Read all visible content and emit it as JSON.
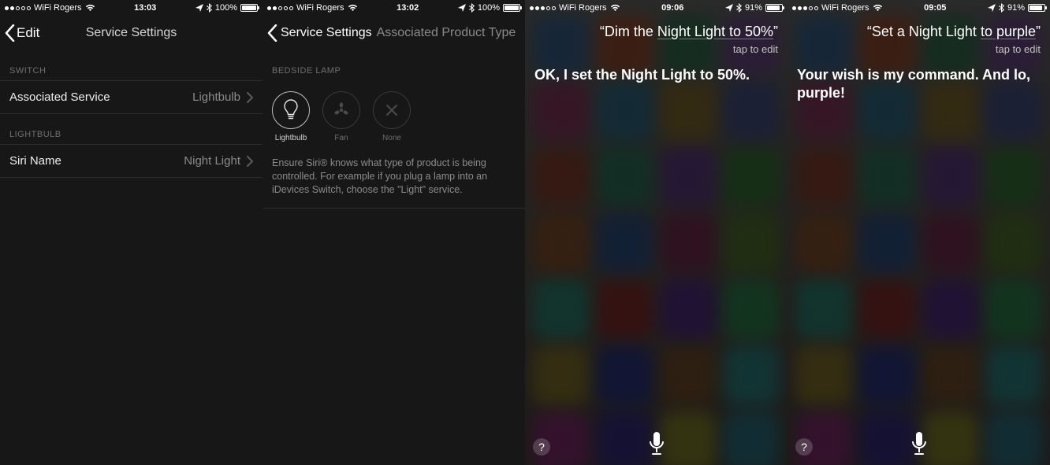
{
  "screens": [
    {
      "status": {
        "carrier": "WiFi Rogers",
        "time": "13:03",
        "battery_pct": "100%",
        "signal_filled": 2,
        "battery_fill_pct": 100
      },
      "nav": {
        "back_label": "Edit",
        "title": "Service Settings"
      },
      "sections": {
        "switch": {
          "header": "SWITCH",
          "row": {
            "label": "Associated Service",
            "value": "Lightbulb"
          }
        },
        "lightbulb": {
          "header": "LIGHTBULB",
          "row": {
            "label": "Siri Name",
            "value": "Night Light"
          }
        }
      }
    },
    {
      "status": {
        "carrier": "WiFi Rogers",
        "time": "13:02",
        "battery_pct": "100%",
        "signal_filled": 2,
        "battery_fill_pct": 100
      },
      "nav": {
        "back_label": "",
        "title": "Service Settings",
        "subtitle": "Associated Product Type"
      },
      "section_header": "BEDSIDE LAMP",
      "types": [
        {
          "key": "lightbulb",
          "label": "Lightbulb",
          "selected": true
        },
        {
          "key": "fan",
          "label": "Fan",
          "selected": false
        },
        {
          "key": "none",
          "label": "None",
          "selected": false
        }
      ],
      "help": "Ensure Siri® knows what type of product is being controlled.  For example if you plug a lamp into an iDevices Switch, choose the \"Light\" service."
    },
    {
      "status": {
        "carrier": "WiFi Rogers",
        "time": "09:06",
        "battery_pct": "91%",
        "signal_filled": 3,
        "battery_fill_pct": 91
      },
      "siri": {
        "utterance_prefix": "“Dim the ",
        "utterance_underlined": "Night Light to 50%",
        "utterance_suffix": "”",
        "tap_to_edit": "tap to edit",
        "response": "OK, I set the Night Light to 50%."
      }
    },
    {
      "status": {
        "carrier": "WiFi Rogers",
        "time": "09:05",
        "battery_pct": "91%",
        "signal_filled": 3,
        "battery_fill_pct": 91
      },
      "siri": {
        "utterance_prefix": "“Set a Night Light ",
        "utterance_underlined": "to purple",
        "utterance_suffix": "”",
        "tap_to_edit": "tap to edit",
        "response": "Your wish is my command. And lo, purple!"
      }
    }
  ],
  "icons": {
    "location": "➤",
    "bluetooth": "✻",
    "help": "?"
  },
  "app_colors": [
    "#3a6ea5",
    "#b5532e",
    "#37805a",
    "#7a4fa3",
    "#a23a6b",
    "#2e7ea0",
    "#9a7b2e",
    "#4a5aa0",
    "#a0452e",
    "#2e8a6a",
    "#6b3fa0",
    "#3a8a3a",
    "#a05a2e",
    "#2e5aa0",
    "#8a2e5a",
    "#5a8a2e",
    "#2ea08a",
    "#a02e2e",
    "#5a2ea0",
    "#2ea05a",
    "#a08a2e",
    "#2e3aa0",
    "#8a5a2e",
    "#2ea0a0",
    "#a02e8a",
    "#3a2ea0",
    "#a0a02e",
    "#2e8aa0"
  ]
}
